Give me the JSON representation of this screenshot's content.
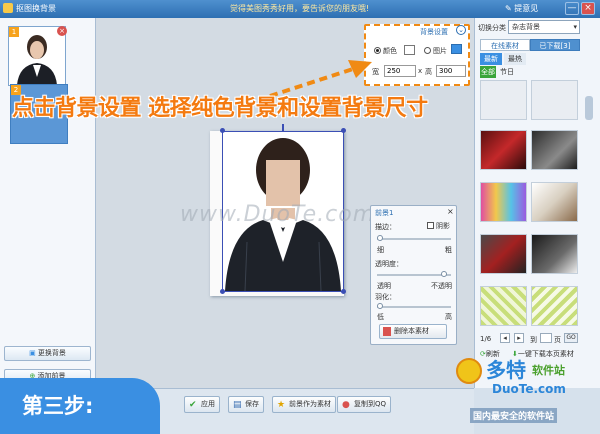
{
  "titlebar": {
    "title": "抠图换背景",
    "ad": "觉得美图秀秀好用，要告诉您的朋友哦!",
    "feedback": "提意见",
    "minimize": "—",
    "close": "×"
  },
  "left": {
    "badge1": "1",
    "badge2": "2",
    "change_bg": "更换背景",
    "add_fg": "添加前景"
  },
  "headline": "点击背景设置 选择纯色背景和设置背景尺寸",
  "step": "第三步:",
  "watermark": "www.DuoTe.com",
  "popup": {
    "title": "背景设置",
    "color_label": "颜色",
    "image_label": "图片",
    "width_label": "宽",
    "width_value": "250",
    "x_sep": "x",
    "height_label": "高",
    "height_value": "300"
  },
  "layer": {
    "title": "前景1",
    "outline_label": "描边：",
    "shadow_label": "阴影",
    "thin": "细",
    "thick": "粗",
    "opacity_label": "透明度：",
    "transparent": "透明",
    "opaque": "不透明",
    "feather_label": "羽化：",
    "low": "低",
    "high": "高",
    "delete_label": "删除本素材"
  },
  "bottom": {
    "apply": "应用",
    "save": "保存",
    "save_as_material": "前景作为素材",
    "copy_qq": "复制到QQ"
  },
  "right": {
    "switch_label": "切换分类",
    "category": "杂志背景",
    "tab_online": "在线素材",
    "tab_downloaded": "已下载[3]",
    "sub_latest": "最新",
    "sub_hot": "最热",
    "tag_all": "全部",
    "tag_holiday": "节日",
    "page": "1/6",
    "goto_label": "到",
    "page_label": "页",
    "go": "GO",
    "refresh": "刷新",
    "download_page": "一键下载本页素材"
  },
  "brand": {
    "name": "多特",
    "sub": "软件站",
    "url": "DuoTe.com",
    "bottom": "国内最安全的软件站"
  },
  "colors": {
    "accent": "#f47a10",
    "blue": "#3a8fe2",
    "title": "#2d6fb2"
  }
}
